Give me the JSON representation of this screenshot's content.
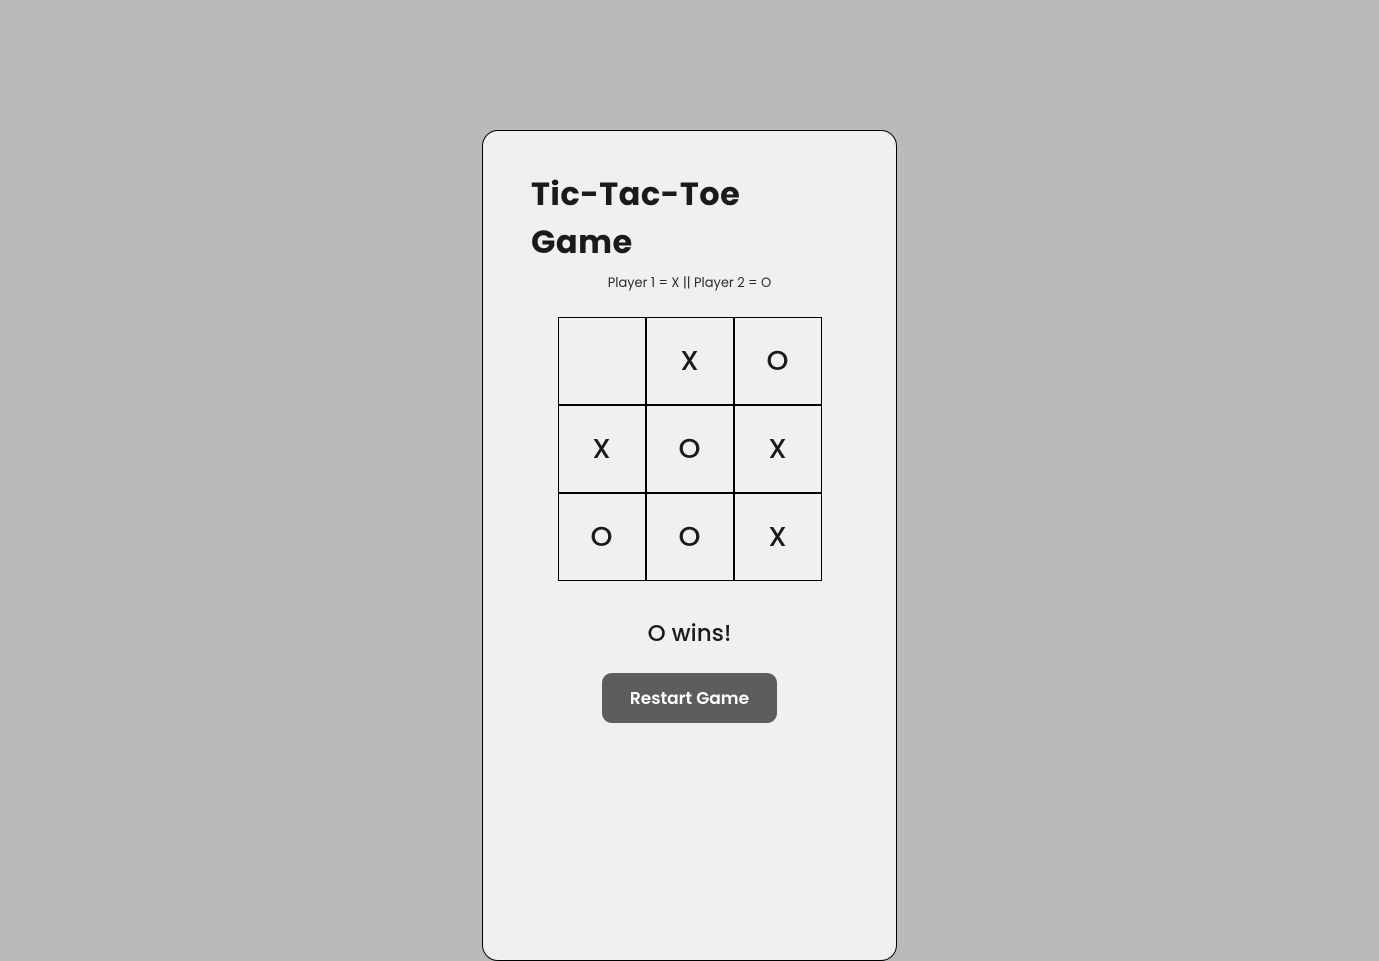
{
  "title": "Tic-Tac-Toe Game",
  "subtitle": "Player 1 = X || Player 2 = O",
  "board": {
    "cells": [
      "",
      "X",
      "O",
      "X",
      "O",
      "X",
      "O",
      "O",
      "X"
    ]
  },
  "status": "O wins!",
  "restart_label": "Restart Game"
}
